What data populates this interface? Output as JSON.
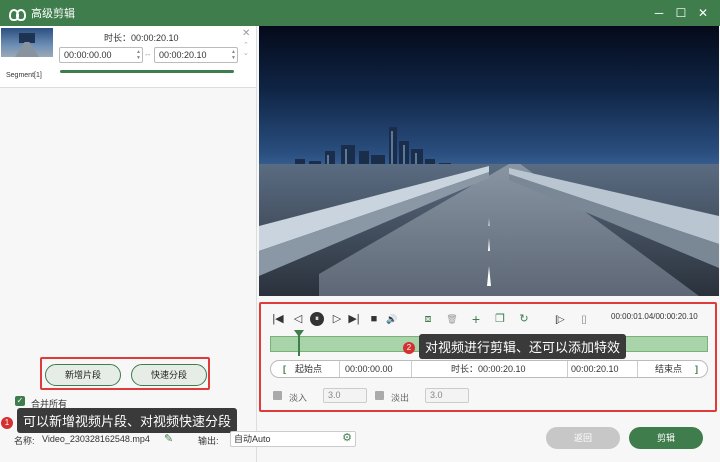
{
  "window": {
    "title": "高级剪辑",
    "min": "─",
    "max": "☐",
    "close": "✕"
  },
  "segment": {
    "label": "Segment[1]",
    "duration_label": "时长：00:00:20.10",
    "start": "00:00:00.00",
    "end": "00:00:20.10",
    "separator": "--",
    "close": "✕",
    "up": "⌃",
    "down": "⌄"
  },
  "left_buttons": {
    "add_segment": "新增片段",
    "quick_split": "快速分段"
  },
  "merge": {
    "label": "合并所有",
    "check": "✓"
  },
  "tooltip1": {
    "num": "1",
    "text": "可以新增视频片段、对视频快速分段"
  },
  "tooltip2": {
    "num": "2",
    "text": "对视频进行剪辑、还可以添加特效"
  },
  "player": {
    "time": "00:00:01.04/00:00:20.10",
    "icons": [
      "start-icon",
      "prev-frame-icon",
      "pause-icon",
      "next-frame-icon",
      "end-icon",
      "stop-icon",
      "volume-icon",
      "split-icon",
      "delete-icon",
      "add-icon",
      "copy-icon",
      "rotate-icon",
      "mark-in-icon",
      "mark-out-icon"
    ],
    "glyphs": {
      "start": "|◀",
      "prev": "◁",
      "pause": "⏸",
      "next": "▷",
      "end": "▶|",
      "stop": "■",
      "volume": "🔊",
      "split": "⧈",
      "delete": "🗑",
      "add": "+",
      "copy": "❐",
      "rotate": "↻",
      "markin": "[▷",
      "markout": "[]"
    }
  },
  "points": {
    "start_label": "起始点",
    "start_time": "00:00:00.00",
    "duration_label": "时长：00:00:20.10",
    "end_time": "00:00:20.10",
    "end_label": "结束点",
    "lbracket": "[",
    "rbracket": "]"
  },
  "fade": {
    "in_label": "淡入",
    "in_value": "3.0",
    "out_label": "淡出",
    "out_value": "3.0"
  },
  "bottom": {
    "name_label": "名称:",
    "name_value": "Video_230328162548.mp4",
    "output_label": "输出:",
    "output_value": "自动Auto",
    "back": "返回",
    "cut": "剪辑"
  },
  "colors": {
    "accent": "#3f7d4d",
    "highlight": "#e03b3b",
    "timeline": "#a9d3a9"
  }
}
